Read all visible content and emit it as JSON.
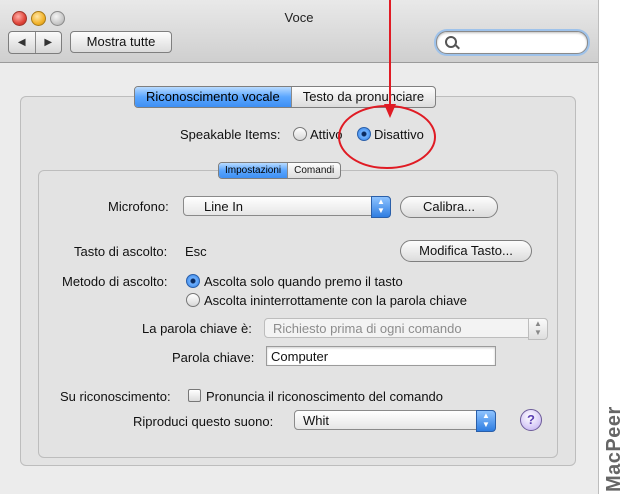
{
  "window": {
    "title": "Voce"
  },
  "toolbar": {
    "back_label": "◀",
    "forward_label": "▶",
    "show_all_label": "Mostra tutte",
    "search_placeholder": ""
  },
  "main_tabs": [
    "Riconoscimento vocale",
    "Testo da pronunciare"
  ],
  "speakable": {
    "label": "Speakable Items:",
    "option_on": "Attivo",
    "option_off": "Disattivo",
    "selected": "Disattivo"
  },
  "sub_tabs": [
    "Impostazioni",
    "Comandi"
  ],
  "microphone": {
    "label": "Microfono:",
    "value": "Line In",
    "calibrate_label": "Calibra..."
  },
  "listening_key": {
    "label": "Tasto di ascolto:",
    "value": "Esc",
    "change_label": "Modifica Tasto..."
  },
  "listening_method": {
    "label": "Metodo di ascolto:",
    "option_1": "Ascolta solo quando premo il tasto",
    "option_2": "Ascolta ininterrottamente con la parola chiave",
    "selected": "Ascolta solo quando premo il tasto"
  },
  "keyword_is": {
    "label": "La parola chiave è:",
    "value": "Richiesto prima di ogni comando"
  },
  "keyword": {
    "label": "Parola chiave:",
    "value": "Computer"
  },
  "recognition": {
    "label": "Su riconoscimento:",
    "checkbox_label": "Pronuncia il riconoscimento del comando",
    "checked": false
  },
  "sound": {
    "label": "Riproduci questo suono:",
    "value": "Whit"
  },
  "help": {
    "label": "?"
  },
  "watermark": "MacPeer",
  "colors": {
    "annotation": "#e01b24",
    "accent": "#3e8ff3"
  }
}
